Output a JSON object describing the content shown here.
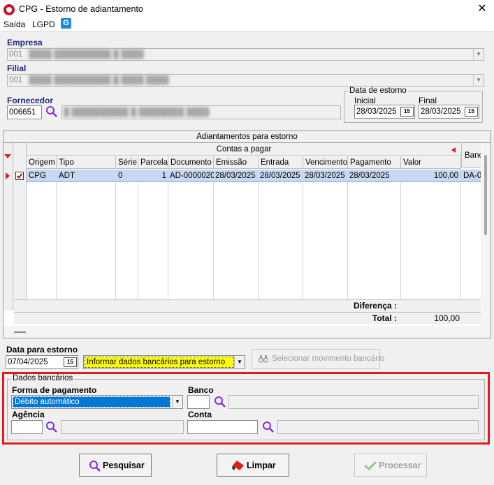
{
  "window": {
    "title": "CPG - Estorno de adiantamento",
    "close_symbol": "✕"
  },
  "menu": {
    "items": [
      "Saída",
      "LGPD"
    ],
    "app_icon_letter": "G"
  },
  "empresa": {
    "label": "Empresa",
    "code": "001"
  },
  "filial": {
    "label": "Filial",
    "code": "001"
  },
  "fornecedor": {
    "label": "Fornecedor",
    "code": "006651"
  },
  "data_estorno": {
    "group_label": "Data de estorno",
    "inicial_label": "Inicial",
    "inicial_value": "28/03/2025",
    "final_label": "Final",
    "final_value": "28/03/2025",
    "cal_icon_text": "15"
  },
  "grid": {
    "section_title": "Adiantamentos para estorno",
    "group_header": "Contas a pagar",
    "truncated_header": "Banc",
    "columns": [
      "Origem",
      "Tipo documento",
      "Série",
      "Parcela",
      "Documento",
      "Emissão",
      "Entrada",
      "Vencimento",
      "Pagamento",
      "Valor"
    ],
    "row": {
      "origem": "CPG",
      "tipo_documento": "ADT",
      "serie": "0",
      "parcela": "1",
      "documento": "AD-0000020",
      "emissao": "28/03/2025",
      "entrada": "28/03/2025",
      "vencimento": "28/03/2025",
      "pagamento": "28/03/2025",
      "valor": "100,00",
      "banco": "DA-0"
    },
    "diferenca_label": "Diferença :",
    "total_label": "Total :",
    "total_value": "100,00"
  },
  "data_para_estorno": {
    "label": "Data para estorno",
    "value": "07/04/2025",
    "dropdown_value": "Informar dados bancários para estorno",
    "selecionar_button": "Selecionar movimento bancário"
  },
  "dados_bancarios": {
    "group_label": "Dados bancários",
    "forma_label": "Forma de pagamento",
    "forma_value": "Débito automático",
    "banco_label": "Banco",
    "agencia_label": "Agência",
    "conta_label": "Conta"
  },
  "buttons": {
    "pesquisar": "Pesquisar",
    "limpar": "Limpar",
    "processar": "Processar"
  },
  "colors": {
    "highlight_yellow": "#ffff00",
    "selection_blue": "#c8d8f0",
    "frame_red": "#e01b1b",
    "accent_purple": "#8a2be2"
  }
}
